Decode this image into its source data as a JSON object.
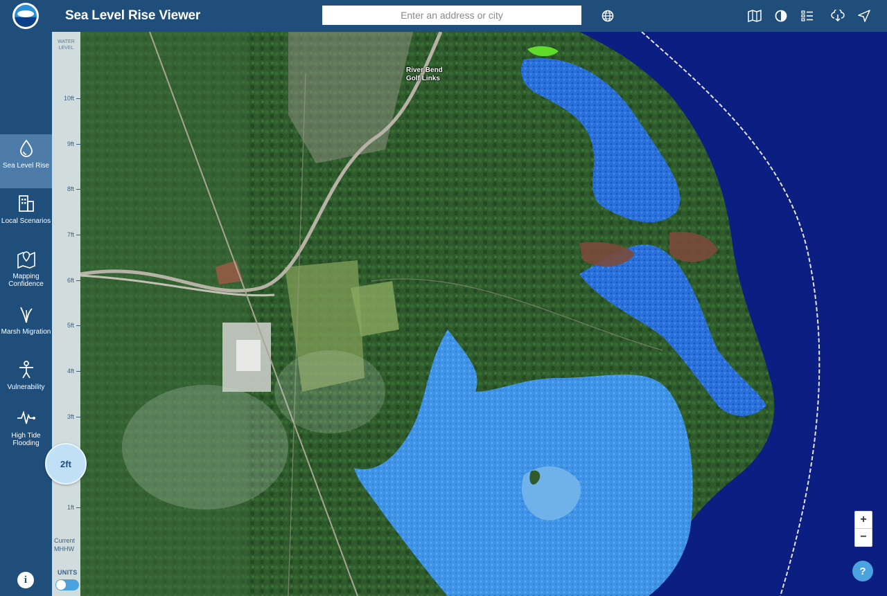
{
  "header": {
    "title": "Sea Level Rise Viewer",
    "search_placeholder": "Enter an address or city",
    "icons": [
      "globe-icon",
      "map-icon",
      "contrast-icon",
      "legend-icon",
      "download-icon",
      "share-icon"
    ]
  },
  "sidebar": {
    "items": [
      {
        "label": "Sea Level Rise",
        "icon": "water-drop-icon",
        "active": true
      },
      {
        "label": "Local Scenarios",
        "icon": "buildings-icon",
        "active": false
      },
      {
        "label": "Mapping Confidence",
        "icon": "map-pin-icon",
        "active": false
      },
      {
        "label": "Marsh Migration",
        "icon": "marsh-grass-icon",
        "active": false
      },
      {
        "label": "Vulnerability",
        "icon": "person-icon",
        "active": false
      },
      {
        "label": "High Tide Flooding",
        "icon": "wave-pulse-icon",
        "active": false
      }
    ],
    "info_label": "i"
  },
  "water_level": {
    "title": "WATER LEVEL",
    "ticks": [
      "10ft",
      "9ft",
      "8ft",
      "7ft",
      "6ft",
      "5ft",
      "4ft",
      "3ft",
      "2ft",
      "1ft"
    ],
    "current_label": "Current MHHW",
    "selected": "2ft",
    "units_label": "UNITS"
  },
  "map": {
    "place_label": "River Bend Golf Links",
    "zoom_in": "+",
    "zoom_out": "−",
    "help": "?"
  },
  "colors": {
    "header_bg": "#1f4e7a",
    "active_nav": "#4d7ca8",
    "deep_water": "#0a1e7a",
    "flood_light": "#4aa3ee",
    "flood_dark": "#1f5fcf",
    "land": "#2f5a2f"
  }
}
